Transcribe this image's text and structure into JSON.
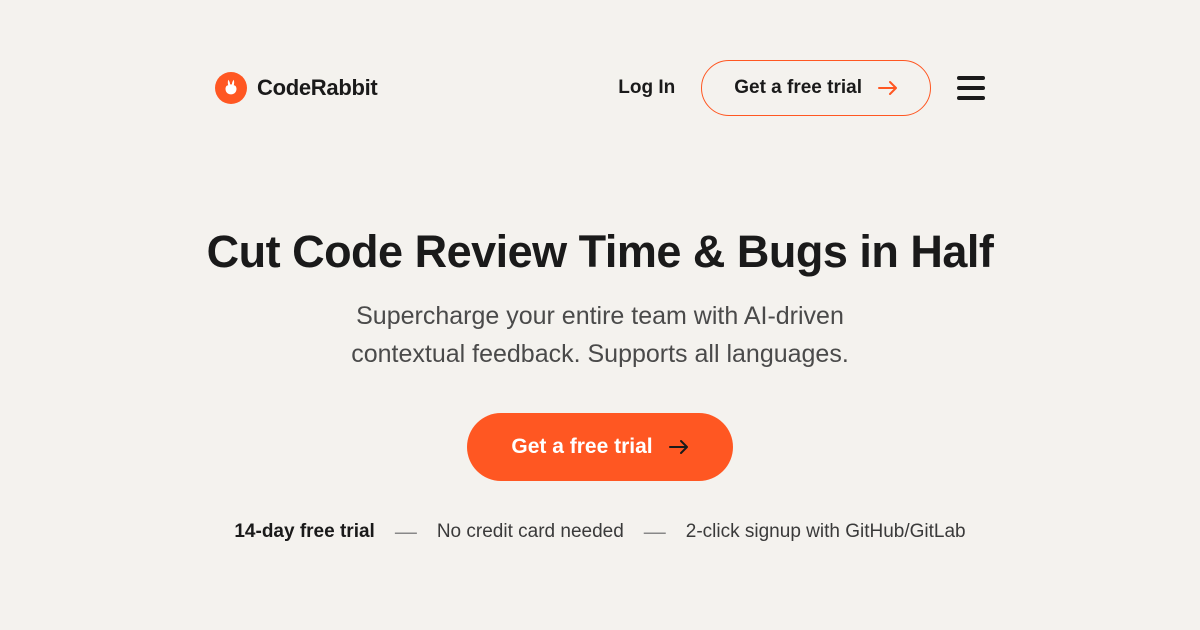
{
  "header": {
    "brand": "CodeRabbit",
    "login": "Log In",
    "trial_button": "Get a free trial"
  },
  "hero": {
    "headline": "Cut Code Review Time & Bugs in Half",
    "subhead_line1": "Supercharge your entire team with AI-driven",
    "subhead_line2": "contextual feedback. Supports all languages.",
    "cta": "Get a free trial",
    "features": {
      "item1": "14-day free trial",
      "item2": "No credit card needed",
      "item3": "2-click signup with GitHub/GitLab"
    }
  },
  "colors": {
    "accent": "#ff5722"
  }
}
